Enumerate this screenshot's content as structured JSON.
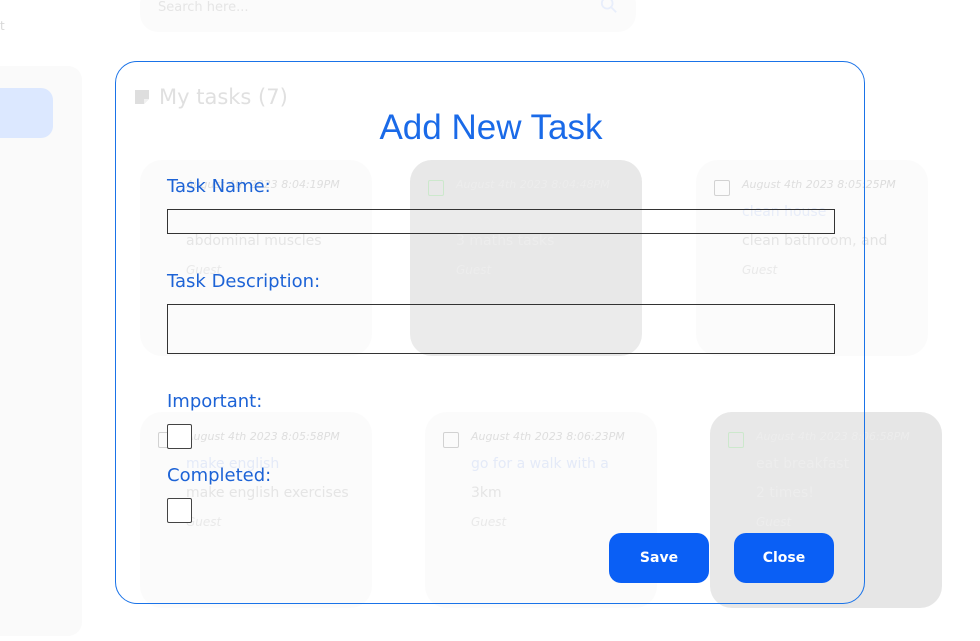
{
  "search": {
    "placeholder": "Search here..."
  },
  "left_letter": "t",
  "page_title": "My tasks (7)",
  "tasks": [
    {
      "date": "August 4th 2023 8:04:19PM",
      "title": "",
      "description": "abdominal muscles",
      "user": "Guest",
      "completed": false,
      "important": true
    },
    {
      "date": "August 4th 2023 8:04:48PM",
      "title": "",
      "description": "3 maths tasks",
      "user": "Guest",
      "completed": true,
      "important": false
    },
    {
      "date": "August 4th 2023 8:05:25PM",
      "title": "clean house",
      "description": "clean bathroom, and",
      "user": "Guest",
      "completed": false,
      "important": false
    },
    {
      "date": "August 4th 2023 8:05:58PM",
      "title": "make english",
      "description": "make english exercises",
      "user": "Guest",
      "completed": false,
      "important": false
    },
    {
      "date": "August 4th 2023 8:06:23PM",
      "title": "go for a walk with a",
      "description": "3km",
      "user": "Guest",
      "completed": false,
      "important": false
    },
    {
      "date": "August 4th 2023 8:06:58PM",
      "title": "eat breakfast",
      "description": "2 times!",
      "user": "Guest",
      "completed": true,
      "important": false
    }
  ],
  "modal": {
    "title": "Add New Task",
    "task_name_label": "Task Name:",
    "task_name_value": "",
    "task_description_label": "Task Description:",
    "task_description_value": "",
    "important_label": "Important:",
    "important_checked": false,
    "completed_label": "Completed:",
    "completed_checked": false,
    "save_label": "Save",
    "close_label": "Close"
  },
  "colors": {
    "accent": "#1a6ae8",
    "button": "#0a5ff5",
    "sidebar_active": "#dce8ff"
  }
}
